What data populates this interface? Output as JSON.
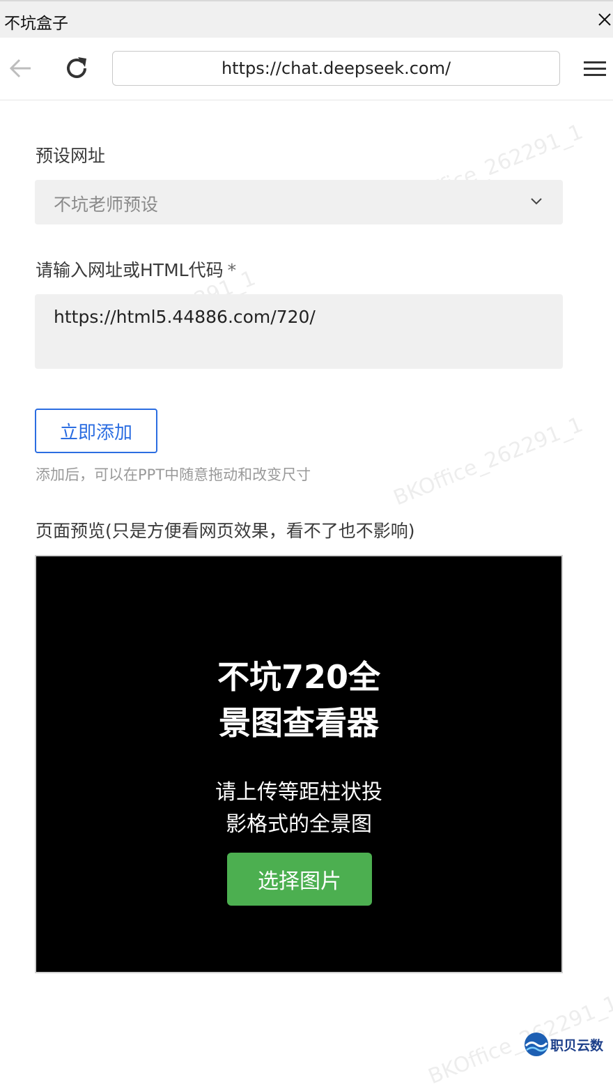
{
  "window": {
    "title": "不坑盒子"
  },
  "browser": {
    "url": "https://chat.deepseek.com/"
  },
  "form": {
    "preset_label": "预设网址",
    "preset_value": "不坑老师预设",
    "input_label": "请输入网址或HTML代码",
    "required_mark": "*",
    "input_value": "https://html5.44886.com/720/",
    "add_button": "立即添加",
    "hint": "添加后，可以在PPT中随意拖动和改变尺寸",
    "preview_label": "页面预览(只是方便看网页效果，看不了也不影响)"
  },
  "preview": {
    "heading_line1": "不坑720全",
    "heading_line2": "景图查看器",
    "sub_line1": "请上传等距柱状投",
    "sub_line2": "影格式的全景图",
    "button": "选择图片"
  },
  "watermark": "BKOffice_262291_1",
  "brand": {
    "name": "职贝云数"
  },
  "colors": {
    "accent": "#2b6de1",
    "green": "#4caf50",
    "preview_bg": "#000000"
  },
  "icons": [
    "close-icon",
    "back-arrow-icon",
    "reload-icon",
    "menu-icon",
    "chevron-down-icon"
  ]
}
